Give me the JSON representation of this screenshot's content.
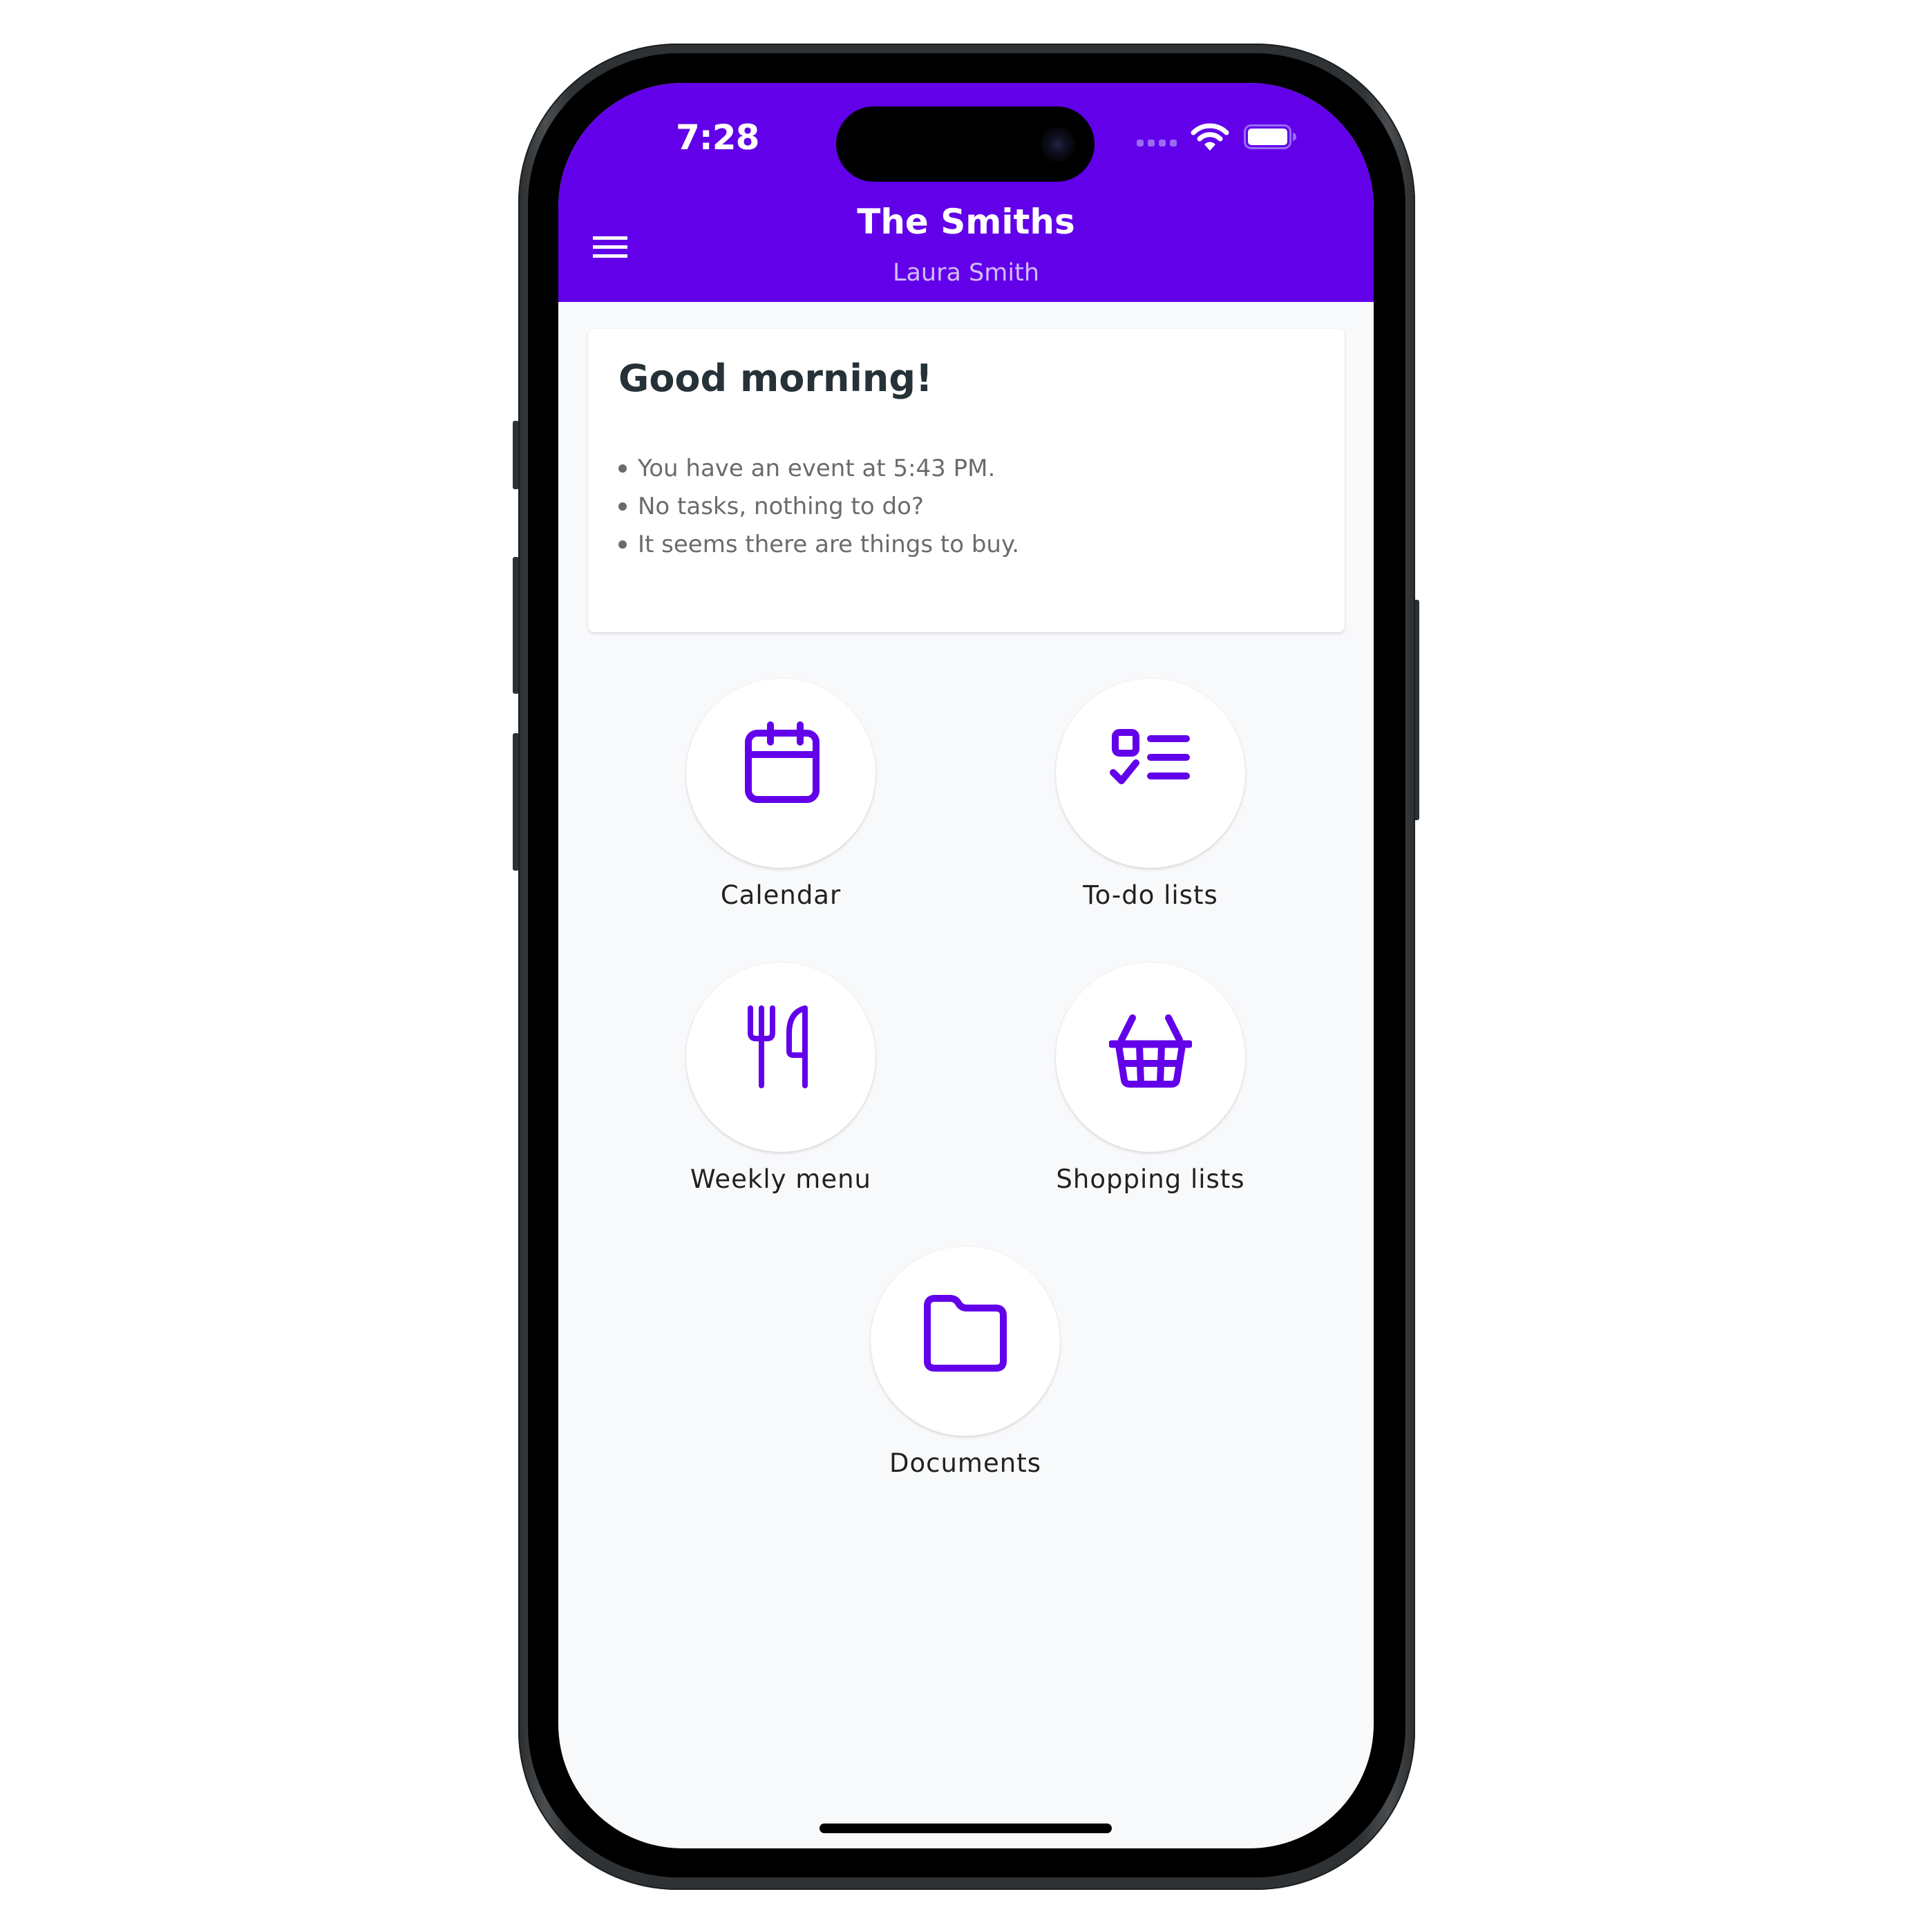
{
  "status_bar": {
    "time": "7:28",
    "signal_icon": "cellular-signal-icon",
    "wifi_icon": "wifi-icon",
    "battery_icon": "battery-icon"
  },
  "header": {
    "menu_icon": "hamburger-menu-icon",
    "title": "The Smiths",
    "subtitle": "Laura Smith"
  },
  "greeting": {
    "title": "Good morning!",
    "items": [
      "You have an event at 5:43 PM.",
      "No tasks, nothing to do?",
      "It seems there are things to buy."
    ]
  },
  "tiles": [
    {
      "label": "Calendar",
      "icon": "calendar-icon"
    },
    {
      "label": "To-do lists",
      "icon": "checklist-icon"
    },
    {
      "label": "Weekly menu",
      "icon": "fork-knife-icon"
    },
    {
      "label": "Shopping lists",
      "icon": "shopping-basket-icon"
    },
    {
      "label": "Documents",
      "icon": "folder-icon"
    }
  ],
  "colors": {
    "primary": "#6200ea",
    "background": "#f8f9fb",
    "card_title": "#263238",
    "card_text": "#6b6b6b",
    "subtitle": "#d2bbfa"
  }
}
